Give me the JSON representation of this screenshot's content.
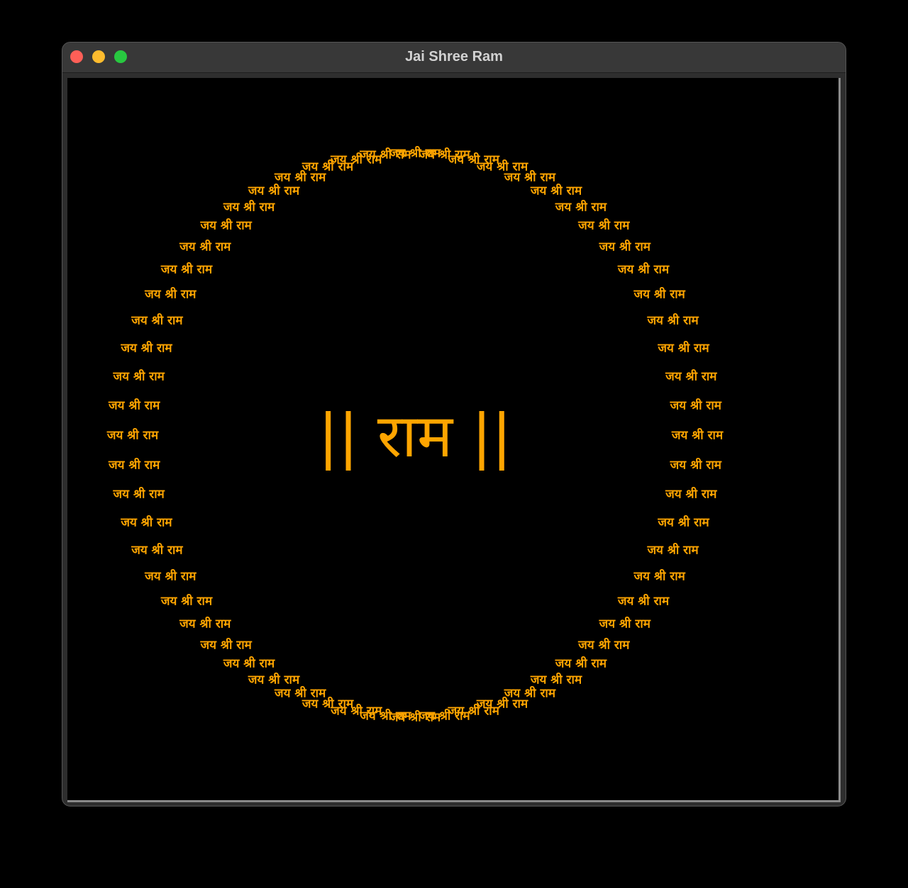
{
  "window": {
    "title": "Jai Shree Ram"
  },
  "canvas": {
    "background_color": "#000000",
    "text_color": "#ffa500",
    "center_text": "|| राम ||",
    "ring_phrase": "जय श्री राम",
    "ring_count": 60
  },
  "traffic_lights": {
    "close_color": "#fe5f57",
    "minimize_color": "#febc2e",
    "zoom_color": "#28c840"
  }
}
